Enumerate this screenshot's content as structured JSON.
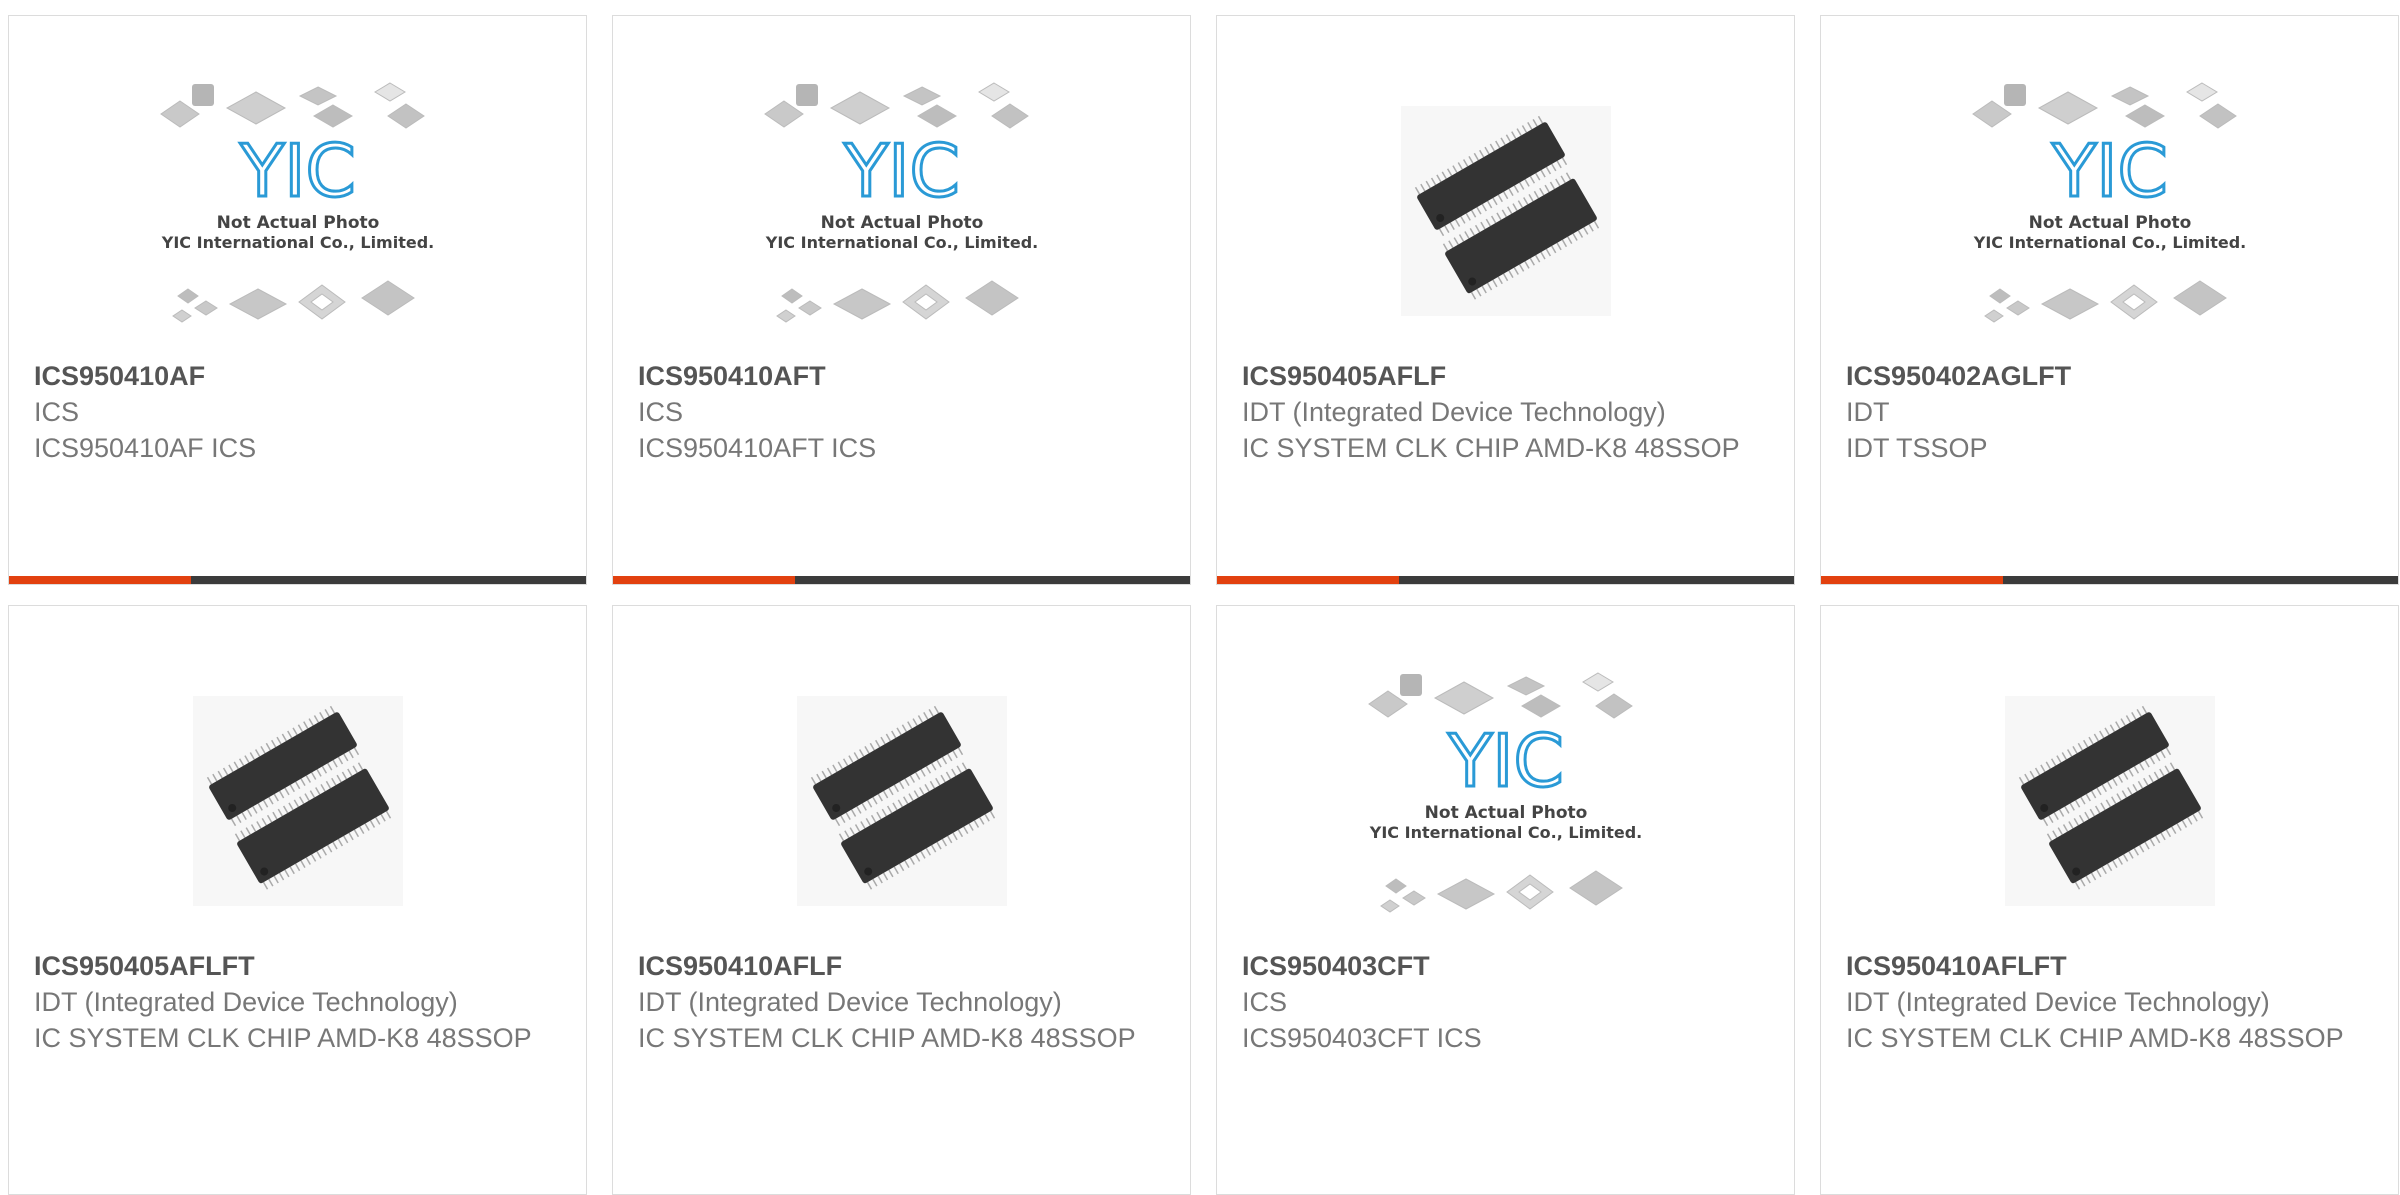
{
  "logo": {
    "brand": "YIC",
    "line1": "Not Actual Photo",
    "line2": "YIC International Co., Limited."
  },
  "colors": {
    "accent": "#e2410f",
    "bar": "#3b3b3b",
    "logo_blue": "#2a9ad6",
    "chip_dark": "#333333"
  },
  "products": [
    {
      "part": "ICS950410AF",
      "manufacturer": "ICS",
      "description": "ICS950410AF ICS",
      "image": "placeholder-logo"
    },
    {
      "part": "ICS950410AFT",
      "manufacturer": "ICS",
      "description": "ICS950410AFT ICS",
      "image": "placeholder-logo"
    },
    {
      "part": "ICS950405AFLF",
      "manufacturer": "IDT (Integrated Device Technology)",
      "description": "IC SYSTEM CLK CHIP AMD-K8 48SSOP",
      "image": "ssop-chips"
    },
    {
      "part": "ICS950402AGLFT",
      "manufacturer": "IDT",
      "description": "IDT TSSOP",
      "image": "placeholder-logo"
    },
    {
      "part": "ICS950405AFLFT",
      "manufacturer": "IDT (Integrated Device Technology)",
      "description": "IC SYSTEM CLK CHIP AMD-K8 48SSOP",
      "image": "ssop-chips"
    },
    {
      "part": "ICS950410AFLF",
      "manufacturer": "IDT (Integrated Device Technology)",
      "description": "IC SYSTEM CLK CHIP AMD-K8 48SSOP",
      "image": "ssop-chips"
    },
    {
      "part": "ICS950403CFT",
      "manufacturer": "ICS",
      "description": "ICS950403CFT ICS",
      "image": "placeholder-logo"
    },
    {
      "part": "ICS950410AFLFT",
      "manufacturer": "IDT (Integrated Device Technology)",
      "description": "IC SYSTEM CLK CHIP AMD-K8 48SSOP",
      "image": "ssop-chips"
    }
  ]
}
